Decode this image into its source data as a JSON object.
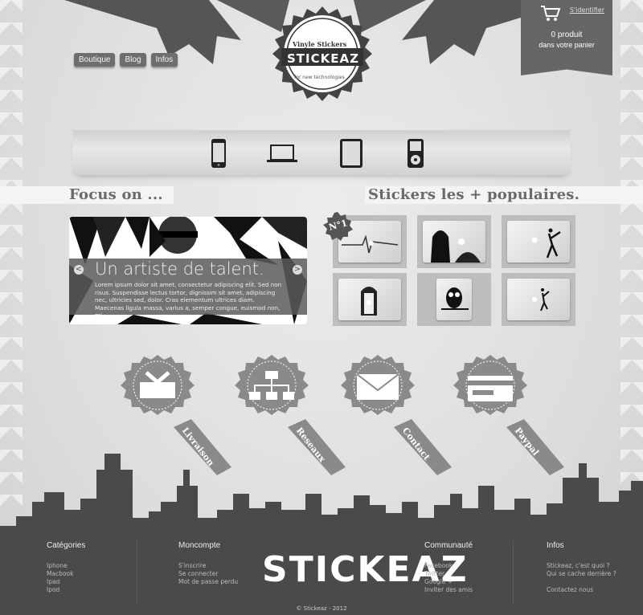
{
  "nav": {
    "items": [
      "Boutique",
      "Blog",
      "Infos"
    ]
  },
  "logo": {
    "top": "Vinyle Stickers",
    "name": "STICKEAZ",
    "tagline": "for new technologies"
  },
  "cart": {
    "login": "S'identifier",
    "count": "0 produit",
    "text": "dans votre panier"
  },
  "devices": [
    "phone-icon",
    "laptop-icon",
    "tablet-icon",
    "ipod-icon"
  ],
  "focus": {
    "title": "Focus on ...",
    "slide_title": "Un artiste de talent.",
    "slide_body": "Lorem ipsum dolor sit amet, consectetur adipiscing elit. Sed non risus. Suspendisse lectus tortor, dignissim sit amet, adipiscing nec, ultricies sed, dolor. Cras elementum ultrices diam. Maecenas ligula massa, varius a, semper congue, euismod non, mi.",
    "prev": "<",
    "next": ">"
  },
  "popular": {
    "title": "Stickers les + populaires.",
    "badge": "N°1",
    "items": [
      "heartbeat-sticker",
      "vader-sticker",
      "banksy-sticker",
      "door-sticker",
      "owl-sticker",
      "dancer-sticker"
    ]
  },
  "badges": [
    {
      "label": "Livraison",
      "icon": "inbox-icon"
    },
    {
      "label": "Reseaux",
      "icon": "network-icon"
    },
    {
      "label": "Contact",
      "icon": "mail-icon"
    },
    {
      "label": "Paypal",
      "icon": "card-icon"
    }
  ],
  "footer": {
    "brand": "STICKEAZ",
    "copyright": "© Stickeaz - 2012",
    "cols": [
      {
        "title": "Catégories",
        "links": [
          "Iphone",
          "Macbook",
          "Ipad",
          "Ipod"
        ]
      },
      {
        "title": "Moncompte",
        "links": [
          "S'inscrire",
          "Se connecter",
          "Mot de passe perdu"
        ]
      },
      {
        "title": "Communauté",
        "links": [
          "Facebook",
          "Twitter",
          "Google +",
          "Inviter des amis"
        ]
      },
      {
        "title": "Infos",
        "links": [
          "Stickeaz, c'est quoi ?",
          "Qui se cache derrière ?",
          "",
          "Contactez nous"
        ]
      }
    ]
  },
  "colors": {
    "dark": "#4a4a4a",
    "panel": "#666666",
    "light": "#f4f4f4"
  }
}
